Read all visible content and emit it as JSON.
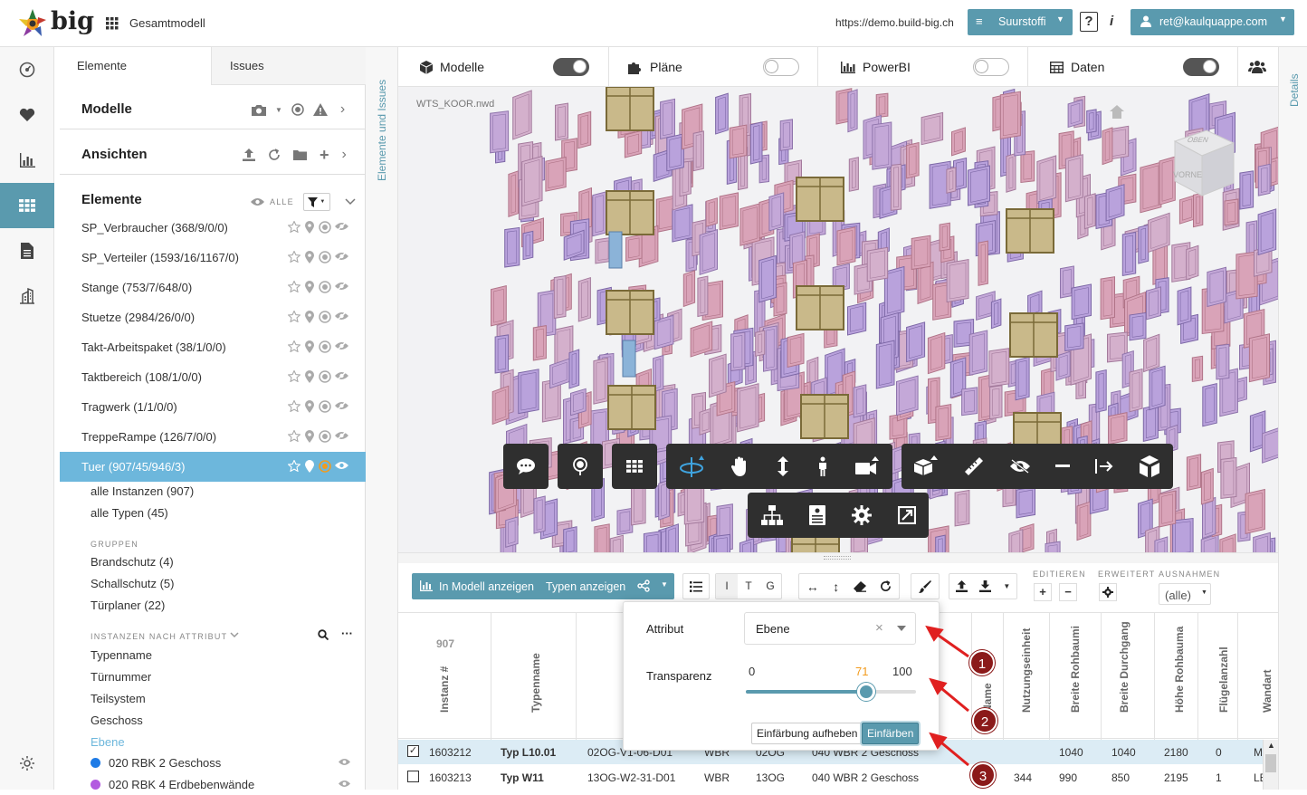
{
  "header": {
    "logo_text": "big",
    "model_title": "Gesamtmodell",
    "url": "https://demo.build-big.ch",
    "project_dropdown": "Suurstoffi",
    "help_label": "?",
    "info_label": "i",
    "user_dropdown": "ret@kaulquappe.com"
  },
  "rail": {
    "icons": [
      "dashboard-icon",
      "heart-icon",
      "bar-chart-icon",
      "grid-icon",
      "document-icon",
      "building-icon",
      "settings-icon"
    ],
    "active": "grid-icon",
    "accent_color": "#5a9aae"
  },
  "panel": {
    "tabs": [
      "Elemente",
      "Issues"
    ],
    "sections": {
      "modelle": "Modelle",
      "ansichten": "Ansichten",
      "elemente": "Elemente",
      "filter_label": "ALLE"
    },
    "elements": [
      {
        "label": "SP_Verbraucher (368/9/0/0)"
      },
      {
        "label": "SP_Verteiler (1593/16/1167/0)"
      },
      {
        "label": "Stange (753/7/648/0)"
      },
      {
        "label": "Stuetze (2984/26/0/0)"
      },
      {
        "label": "Takt-Arbeitspaket (38/1/0/0)"
      },
      {
        "label": "Taktbereich (108/1/0/0)"
      },
      {
        "label": "Tragwerk (1/1/0/0)"
      },
      {
        "label": "TreppeRampe (126/7/0/0)"
      },
      {
        "label": "Tuer (907/45/946/3)",
        "selected": true
      }
    ],
    "tuer_sub": [
      "alle Instanzen (907)",
      "alle Typen (45)"
    ],
    "gruppen_caption": "GRUPPEN",
    "gruppen": [
      "Brandschutz (4)",
      "Schallschutz (5)",
      "Türplaner (22)"
    ],
    "attr_caption": "INSTANZEN NACH ATTRIBUT",
    "attributes": [
      "Typenname",
      "Türnummer",
      "Teilsystem",
      "Geschoss",
      "Ebene"
    ],
    "active_attribute": "Ebene",
    "ebene_values": [
      {
        "label": "020 RBK 2 Geschoss",
        "color": "#1e7be6"
      },
      {
        "label": "020 RBK 4 Erdbebenwände",
        "color": "#b35be0"
      }
    ]
  },
  "strips": {
    "left_vertical": "Elemente und Issues",
    "right_vertical": "Details"
  },
  "view_tabs": [
    {
      "label": "Modelle",
      "icon": "cube-icon",
      "on": true
    },
    {
      "label": "Pläne",
      "icon": "puzzle-icon",
      "on": false
    },
    {
      "label": "PowerBI",
      "icon": "bar-chart-icon",
      "on": false
    },
    {
      "label": "Daten",
      "icon": "table-icon",
      "on": true
    }
  ],
  "viewer": {
    "file_name": "WTS_KOOR.nwd",
    "viewcube_labels": [
      "OBEN",
      "VORNE"
    ],
    "toolbar_row1": [
      "comment-icon",
      "pin-icon",
      "grid-icon",
      "orbit-icon",
      "pan-icon",
      "zoom-icon",
      "walk-icon",
      "camera-icon",
      "model-browser-icon",
      "measure-icon",
      "hide-icon",
      "minus-icon",
      "export-icon",
      "explode-icon"
    ],
    "toolbar_row2": [
      "structure-icon",
      "properties-icon",
      "settings-icon",
      "fullscreen-icon"
    ]
  },
  "grid_toolbar": {
    "show_in_model": "In Modell anzeigen",
    "show_types": "Typen anzeigen",
    "view_letters": [
      "I",
      "T",
      "G"
    ],
    "editieren_caption": "EDITIEREN",
    "erweitert_caption": "ERWEITERT",
    "ausnahmen_caption": "AUSNAHMEN",
    "ausnahmen_value": "(alle)"
  },
  "table": {
    "count": "907",
    "headers": [
      "Instanz #",
      "Typenname",
      "Name",
      "Nutzungseinheit",
      "Breite Rohbaumi",
      "Breite Durchgang",
      "Höhe Rohbauma",
      "Flügelanzahl",
      "Wandart"
    ],
    "rows": [
      {
        "checked": true,
        "instanz": "1603212",
        "typ": "Typ L10.01",
        "tuer": "02OG-V1-06-D01",
        "sys": "WBR",
        "geschoss": "02OG",
        "ebene": "040 WBR 2 Geschoss",
        "nutz": "",
        "breite_r": "1040",
        "breite_d": "1040",
        "hoehe": "2180",
        "fluegel": "0",
        "wandart": "ML"
      },
      {
        "checked": false,
        "instanz": "1603213",
        "typ": "Typ W11",
        "tuer": "13OG-W2-31-D01",
        "sys": "WBR",
        "geschoss": "13OG",
        "ebene": "040 WBR 2 Geschoss",
        "nutz": "344",
        "breite_r": "990",
        "breite_d": "850",
        "hoehe": "2195",
        "fluegel": "1",
        "wandart": "LE"
      }
    ]
  },
  "popup": {
    "attribut_label": "Attribut",
    "attribut_value": "Ebene",
    "transparenz_label": "Transparenz",
    "slider_min": "0",
    "slider_value": "71",
    "slider_max": "100",
    "slider_fraction": 0.71,
    "reset_button": "Einfärbung aufheben",
    "apply_button": "Einfärben"
  },
  "annotations": [
    "1",
    "2",
    "3"
  ]
}
